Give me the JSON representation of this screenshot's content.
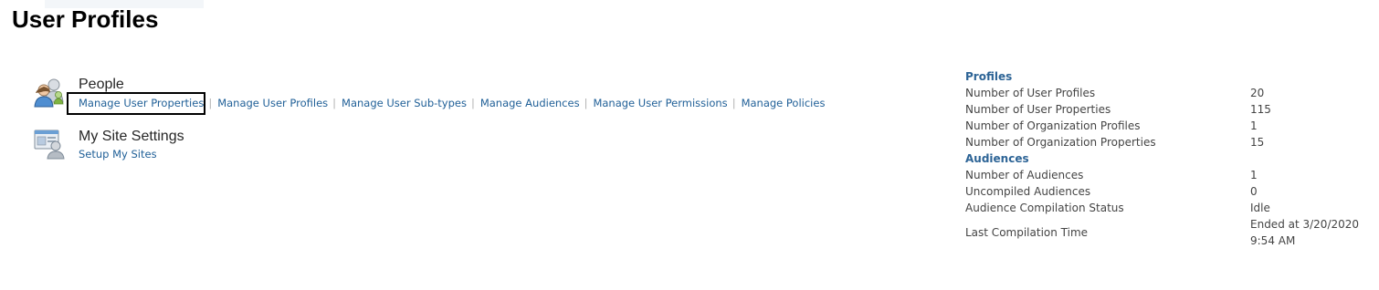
{
  "page": {
    "title": "User Profiles"
  },
  "people": {
    "heading": "People",
    "icon": "people-icon",
    "links": [
      "Manage User Properties",
      "Manage User Profiles",
      "Manage User Sub-types",
      "Manage Audiences",
      "Manage User Permissions",
      "Manage Policies"
    ]
  },
  "mysite": {
    "heading": "My Site Settings",
    "icon": "my-site-icon",
    "links": [
      "Setup My Sites"
    ]
  },
  "stats": {
    "profiles_heading": "Profiles",
    "profiles": [
      {
        "label": "Number of User Profiles",
        "value": "20"
      },
      {
        "label": "Number of User Properties",
        "value": "115"
      },
      {
        "label": "Number of Organization Profiles",
        "value": "1"
      },
      {
        "label": "Number of Organization Properties",
        "value": "15"
      }
    ],
    "audiences_heading": "Audiences",
    "audiences": [
      {
        "label": "Number of Audiences",
        "value": "1"
      },
      {
        "label": "Uncompiled Audiences",
        "value": "0"
      },
      {
        "label": "Audience Compilation Status",
        "value": "Idle"
      },
      {
        "label": "Last Compilation Time",
        "value": "Ended at 3/20/2020 9:54 AM"
      }
    ]
  },
  "colors": {
    "link": "#1f5f97",
    "group_heading": "#2d6496",
    "text": "#444444",
    "title": "#000000"
  }
}
